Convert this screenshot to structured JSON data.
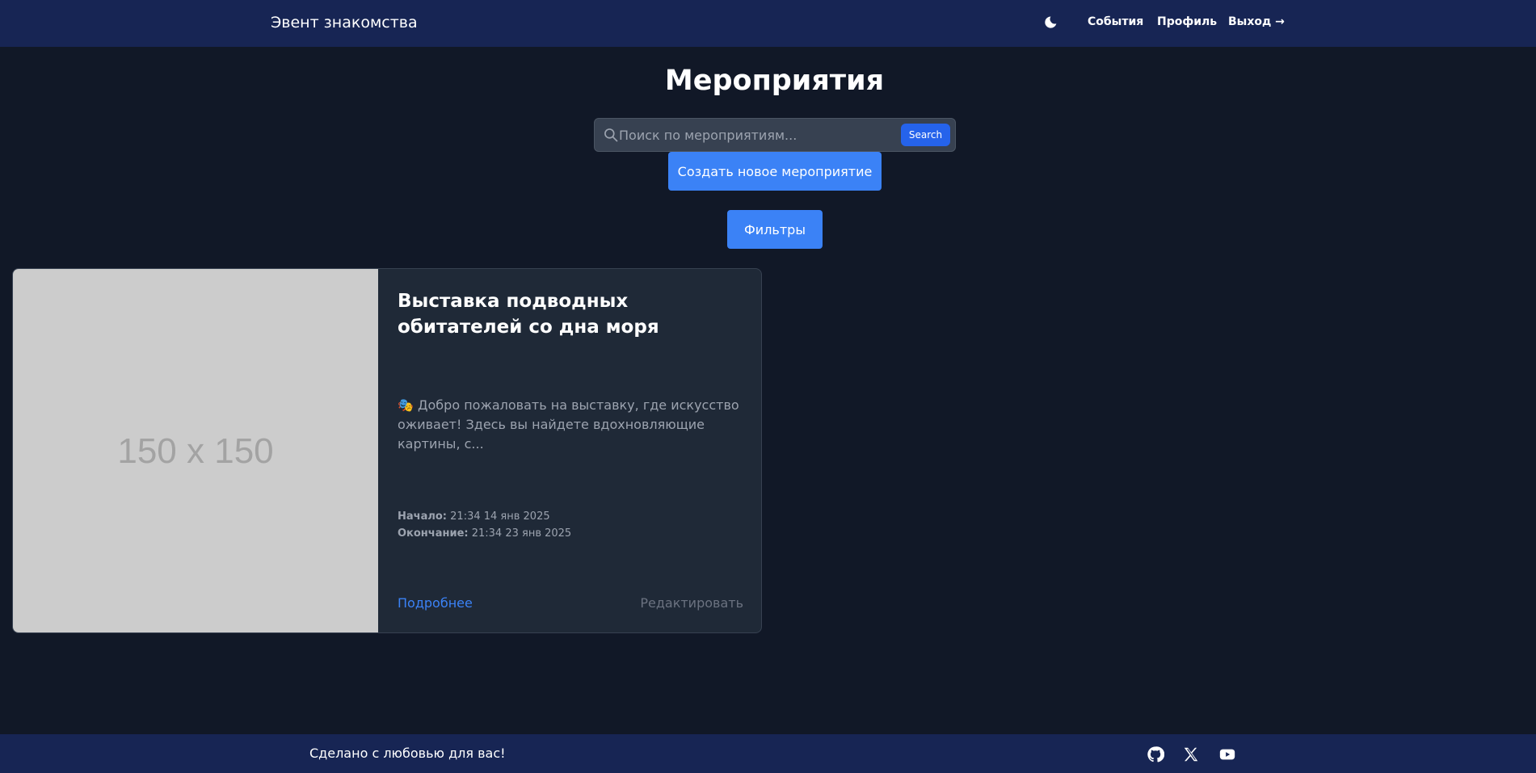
{
  "navbar": {
    "brand": "Эвент знакомства",
    "theme_icon": "moon-icon",
    "links": {
      "events": "События",
      "profile": "Профиль",
      "logout": "Выход →"
    }
  },
  "main": {
    "title": "Мероприятия",
    "search": {
      "placeholder": "Поиск по мероприятиям...",
      "value": "",
      "button": "Search"
    },
    "create_button": "Создать новое мероприятие",
    "filters_button": "Фильтры"
  },
  "events": [
    {
      "image_text": "150 x 150",
      "title": "Выставка подводных обитателей со дна моря",
      "description": "🎭 Добро пожаловать на выставку, где искусство оживает! Здесь вы найдете вдохновляющие картины, с...",
      "start_label": "Начало:",
      "start_value": "21:34 14 янв 2025",
      "end_label": "Окончание:",
      "end_value": "21:34 23 янв 2025",
      "more_link": "Подробнее",
      "edit_link": "Редактировать"
    }
  ],
  "footer": {
    "text": "Сделано с любовью для вас!",
    "social_icons": [
      "github-icon",
      "x-icon",
      "youtube-icon"
    ]
  },
  "colors": {
    "background": "#111827",
    "navbar": "#172554",
    "card": "#1f2937",
    "accent": "#3b82f6",
    "muted": "#9ca3af"
  }
}
